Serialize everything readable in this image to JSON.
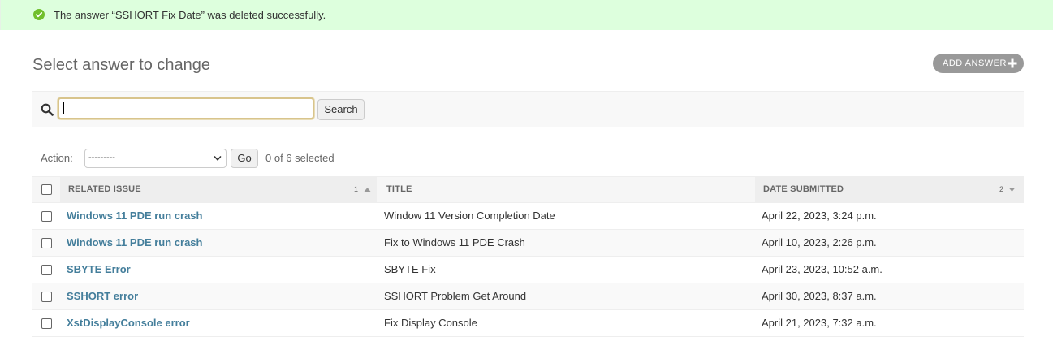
{
  "message": {
    "text": "The answer “SSHORT Fix Date” was deleted successfully.",
    "icon": "check-circle-icon",
    "color": "#70bf2b"
  },
  "header": {
    "title": "Select answer to change",
    "add_label": "ADD ANSWER"
  },
  "search": {
    "placeholder": "",
    "value": "",
    "button_label": "Search"
  },
  "actions": {
    "label": "Action:",
    "selected_option": "---------",
    "go_label": "Go",
    "selected_count": "0 of 6 selected"
  },
  "table": {
    "columns": [
      {
        "label": "RELATED ISSUE",
        "sort_order": "1",
        "sort_dir": "asc"
      },
      {
        "label": "TITLE"
      },
      {
        "label": "DATE SUBMITTED",
        "sort_order": "2",
        "sort_dir": "desc"
      }
    ],
    "rows": [
      {
        "issue": "Windows 11 PDE run crash",
        "title": "Window 11 Version Completion Date",
        "date": "April 22, 2023, 3:24 p.m."
      },
      {
        "issue": "Windows 11 PDE run crash",
        "title": "Fix to Windows 11 PDE Crash",
        "date": "April 10, 2023, 2:26 p.m."
      },
      {
        "issue": "SBYTE Error",
        "title": "SBYTE Fix",
        "date": "April 23, 2023, 10:52 a.m."
      },
      {
        "issue": "SSHORT error",
        "title": "SSHORT Problem Get Around",
        "date": "April 30, 2023, 8:37 a.m."
      },
      {
        "issue": "XstDisplayConsole error",
        "title": "Fix Display Console",
        "date": "April 21, 2023, 7:32 a.m."
      }
    ]
  },
  "colors": {
    "link": "#447e9b",
    "success_bg": "#ddffdd",
    "add_button": "#999999"
  }
}
